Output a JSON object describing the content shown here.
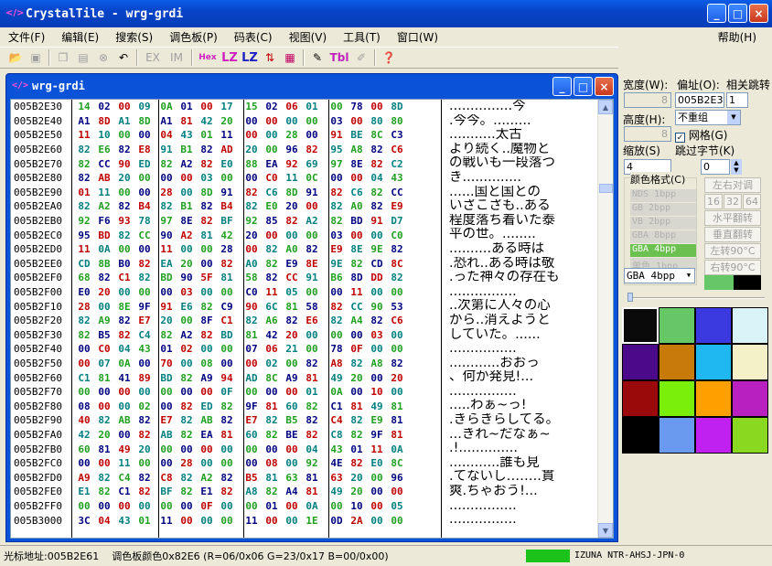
{
  "app": {
    "icon": "crystaltile-logo-icon",
    "title": "CrystalTile - wrg-grdi",
    "buttons": [
      "_",
      "□",
      "×"
    ]
  },
  "menu": [
    "文件(F)",
    "编辑(E)",
    "搜索(S)",
    "调色板(P)",
    "码表(C)",
    "视图(V)",
    "工具(T)",
    "窗口(W)",
    "帮助(H)"
  ],
  "toolbar": {
    "items": [
      "open-icon",
      "save-icon",
      "copy-icon",
      "paste-icon",
      "stop-icon",
      "undo-icon",
      "EX",
      "IM",
      "Hex",
      "LZ",
      "LZ",
      "sort-icon",
      "grid-icon",
      "brush-icon",
      "Tbl",
      "pen-icon",
      "help-icon"
    ]
  },
  "hexwin": {
    "title": "wrg-grdi",
    "rows": [
      {
        "a": "005B2E30",
        "b": [
          "14",
          "02",
          "00",
          "09",
          "0A",
          "01",
          "00",
          "17",
          "15",
          "02",
          "06",
          "01",
          "00",
          "78",
          "00",
          "8D"
        ],
        "t": "...............今"
      },
      {
        "a": "005B2E40",
        "b": [
          "A1",
          "8D",
          "A1",
          "8D",
          "A1",
          "81",
          "42",
          "20",
          "00",
          "00",
          "00",
          "00",
          "03",
          "00",
          "80",
          "80"
        ],
        "t": ".今今。........."
      },
      {
        "a": "005B2E50",
        "b": [
          "11",
          "10",
          "00",
          "00",
          "04",
          "43",
          "01",
          "11",
          "00",
          "00",
          "28",
          "00",
          "91",
          "BE",
          "8C",
          "C3"
        ],
        "t": "...........太古"
      },
      {
        "a": "005B2E60",
        "b": [
          "82",
          "E6",
          "82",
          "E8",
          "91",
          "B1",
          "82",
          "AD",
          "20",
          "00",
          "96",
          "82",
          "95",
          "A8",
          "82",
          "C6"
        ],
        "t": "より続く..魔物と"
      },
      {
        "a": "005B2E70",
        "b": [
          "82",
          "CC",
          "90",
          "ED",
          "82",
          "A2",
          "82",
          "E0",
          "88",
          "EA",
          "92",
          "69",
          "97",
          "8E",
          "82",
          "C2"
        ],
        "t": "の戦いも一段落つ"
      },
      {
        "a": "005B2E80",
        "b": [
          "82",
          "AB",
          "20",
          "00",
          "00",
          "00",
          "03",
          "00",
          "00",
          "C0",
          "11",
          "0C",
          "00",
          "00",
          "04",
          "43"
        ],
        "t": "き.............."
      },
      {
        "a": "005B2E90",
        "b": [
          "01",
          "11",
          "00",
          "00",
          "28",
          "00",
          "8D",
          "91",
          "82",
          "C6",
          "8D",
          "91",
          "82",
          "C6",
          "82",
          "CC"
        ],
        "t": "......国と国との"
      },
      {
        "a": "005B2EA0",
        "b": [
          "82",
          "A2",
          "82",
          "B4",
          "82",
          "B1",
          "82",
          "B4",
          "82",
          "E0",
          "20",
          "00",
          "82",
          "A0",
          "82",
          "E9"
        ],
        "t": "いざこざも..ある"
      },
      {
        "a": "005B2EB0",
        "b": [
          "92",
          "F6",
          "93",
          "78",
          "97",
          "8E",
          "82",
          "BF",
          "92",
          "85",
          "82",
          "A2",
          "82",
          "BD",
          "91",
          "D7"
        ],
        "t": "程度落ち着いた泰"
      },
      {
        "a": "005B2EC0",
        "b": [
          "95",
          "BD",
          "82",
          "CC",
          "90",
          "A2",
          "81",
          "42",
          "20",
          "00",
          "00",
          "00",
          "03",
          "00",
          "00",
          "C0"
        ],
        "t": "平の世。........"
      },
      {
        "a": "005B2ED0",
        "b": [
          "11",
          "0A",
          "00",
          "00",
          "11",
          "00",
          "00",
          "28",
          "00",
          "82",
          "A0",
          "82",
          "E9",
          "8E",
          "9E",
          "82"
        ],
        "t": "..........ある時は"
      },
      {
        "a": "005B2EE0",
        "b": [
          "CD",
          "8B",
          "B0",
          "82",
          "EA",
          "20",
          "00",
          "82",
          "A0",
          "82",
          "E9",
          "8E",
          "9E",
          "82",
          "CD",
          "8C"
        ],
        "t": ".恐れ..ある時は敬"
      },
      {
        "a": "005B2EF0",
        "b": [
          "68",
          "82",
          "C1",
          "82",
          "BD",
          "90",
          "5F",
          "81",
          "58",
          "82",
          "CC",
          "91",
          "B6",
          "8D",
          "DD",
          "82"
        ],
        "t": ".った神々の存在も"
      },
      {
        "a": "005B2F00",
        "b": [
          "E0",
          "20",
          "00",
          "00",
          "00",
          "03",
          "00",
          "00",
          "C0",
          "11",
          "05",
          "00",
          "00",
          "11",
          "00",
          "00"
        ],
        "t": "................"
      },
      {
        "a": "005B2F10",
        "b": [
          "28",
          "00",
          "8E",
          "9F",
          "91",
          "E6",
          "82",
          "C9",
          "90",
          "6C",
          "81",
          "58",
          "82",
          "CC",
          "90",
          "53"
        ],
        "t": "..次第に人々の心"
      },
      {
        "a": "005B2F20",
        "b": [
          "82",
          "A9",
          "82",
          "E7",
          "20",
          "00",
          "8F",
          "C1",
          "82",
          "A6",
          "82",
          "E6",
          "82",
          "A4",
          "82",
          "C6"
        ],
        "t": "から..消えようと"
      },
      {
        "a": "005B2F30",
        "b": [
          "82",
          "B5",
          "82",
          "C4",
          "82",
          "A2",
          "82",
          "BD",
          "81",
          "42",
          "20",
          "00",
          "00",
          "00",
          "03",
          "00"
        ],
        "t": "していた。......"
      },
      {
        "a": "005B2F40",
        "b": [
          "00",
          "C0",
          "04",
          "43",
          "01",
          "02",
          "00",
          "00",
          "07",
          "06",
          "21",
          "00",
          "78",
          "0F",
          "00",
          "00"
        ],
        "t": "................"
      },
      {
        "a": "005B2F50",
        "b": [
          "00",
          "07",
          "0A",
          "00",
          "70",
          "00",
          "08",
          "00",
          "00",
          "02",
          "00",
          "82",
          "A8",
          "82",
          "A8",
          "82"
        ],
        "t": "............おおっ"
      },
      {
        "a": "005B2F60",
        "b": [
          "C1",
          "81",
          "41",
          "89",
          "BD",
          "82",
          "A9",
          "94",
          "AD",
          "8C",
          "A9",
          "81",
          "49",
          "20",
          "00",
          "20"
        ],
        "t": "、何か発見!..."
      },
      {
        "a": "005B2F70",
        "b": [
          "00",
          "00",
          "00",
          "00",
          "00",
          "00",
          "00",
          "0F",
          "00",
          "00",
          "00",
          "01",
          "0A",
          "00",
          "10",
          "00"
        ],
        "t": "................"
      },
      {
        "a": "005B2F80",
        "b": [
          "08",
          "00",
          "00",
          "02",
          "00",
          "82",
          "ED",
          "82",
          "9F",
          "81",
          "60",
          "82",
          "C1",
          "81",
          "49",
          "81"
        ],
        "t": ".....わぁ~っ!"
      },
      {
        "a": "005B2F90",
        "b": [
          "40",
          "82",
          "AB",
          "82",
          "E7",
          "82",
          "AB",
          "82",
          "E7",
          "82",
          "B5",
          "82",
          "C4",
          "82",
          "E9",
          "81"
        ],
        "t": ".きらきらしてる。"
      },
      {
        "a": "005B2FA0",
        "b": [
          "42",
          "20",
          "00",
          "82",
          "AB",
          "82",
          "EA",
          "81",
          "60",
          "82",
          "BE",
          "82",
          "C8",
          "82",
          "9F",
          "81"
        ],
        "t": "...きれ~だなぁ~"
      },
      {
        "a": "005B2FB0",
        "b": [
          "60",
          "81",
          "49",
          "20",
          "00",
          "00",
          "00",
          "00",
          "00",
          "00",
          "00",
          "04",
          "43",
          "01",
          "11",
          "0A"
        ],
        "t": ".!.............."
      },
      {
        "a": "005B2FC0",
        "b": [
          "00",
          "00",
          "11",
          "00",
          "00",
          "28",
          "00",
          "00",
          "00",
          "08",
          "00",
          "92",
          "4E",
          "82",
          "E0",
          "8C"
        ],
        "t": "............誰も見"
      },
      {
        "a": "005B2FD0",
        "b": [
          "A9",
          "82",
          "C4",
          "82",
          "C8",
          "82",
          "A2",
          "82",
          "B5",
          "81",
          "63",
          "81",
          "63",
          "20",
          "00",
          "96"
        ],
        "t": ".てないし……..貫"
      },
      {
        "a": "005B2FE0",
        "b": [
          "E1",
          "82",
          "C1",
          "82",
          "BF",
          "82",
          "E1",
          "82",
          "A8",
          "82",
          "A4",
          "81",
          "49",
          "20",
          "00",
          "00"
        ],
        "t": "爽.ちゃおう!..."
      },
      {
        "a": "005B2FF0",
        "b": [
          "00",
          "00",
          "00",
          "00",
          "00",
          "00",
          "0F",
          "00",
          "00",
          "01",
          "00",
          "0A",
          "00",
          "10",
          "00",
          "05"
        ],
        "t": "................"
      },
      {
        "a": "005B3000",
        "b": [
          "3C",
          "04",
          "43",
          "01",
          "11",
          "00",
          "00",
          "00",
          "11",
          "00",
          "00",
          "1E",
          "0D",
          "2A",
          "00",
          "00"
        ],
        "t": "................"
      }
    ]
  },
  "panel": {
    "width_label": "宽度(W):",
    "width_val": "8",
    "offset_label": "偏址(O):",
    "offset_val": "005B2E30",
    "jump_label": "相关跳转",
    "jump_val": "1",
    "height_label": "高度(H):",
    "height_val": "8",
    "fmt_select": "不重组",
    "grid_label": "网格(G)",
    "zoom_label": "缩放(S)",
    "zoom_val": "4",
    "skip_label": "跳过字节(K)",
    "skip_val": "0",
    "colorfmt_label": "颜色格式(C)",
    "formats": [
      "NDS  1bpp",
      "GB   2bpp",
      "VB   2bpp",
      "GBA  8bpp",
      "GBA  4bpp",
      "单色 1bpp"
    ],
    "fmt_current": "GBA  4bpp",
    "btns": [
      "左右对调",
      "16",
      "32",
      "64",
      "水平翻转",
      "垂直翻转",
      "左转90°C",
      "右转90°C"
    ],
    "palette": [
      "#0a0a0a",
      "#66c766",
      "#3a3ae0",
      "#d8f4f8",
      "#4a0a8a",
      "#c87a0a",
      "#20b8f0",
      "#f4f0c8",
      "#9a0a0a",
      "#7af00a",
      "#ffa000",
      "#b820c0",
      "#000000",
      "#6a9af0",
      "#c020f0",
      "#8ad820"
    ]
  },
  "status": {
    "cursor": "光标地址:005B2E61",
    "palette": "调色板颜色0x82E6 (R=06/0x06 G=23/0x17 B=00/0x00)",
    "rom": "IZUNA NTR-AHSJ-JPN-0"
  }
}
